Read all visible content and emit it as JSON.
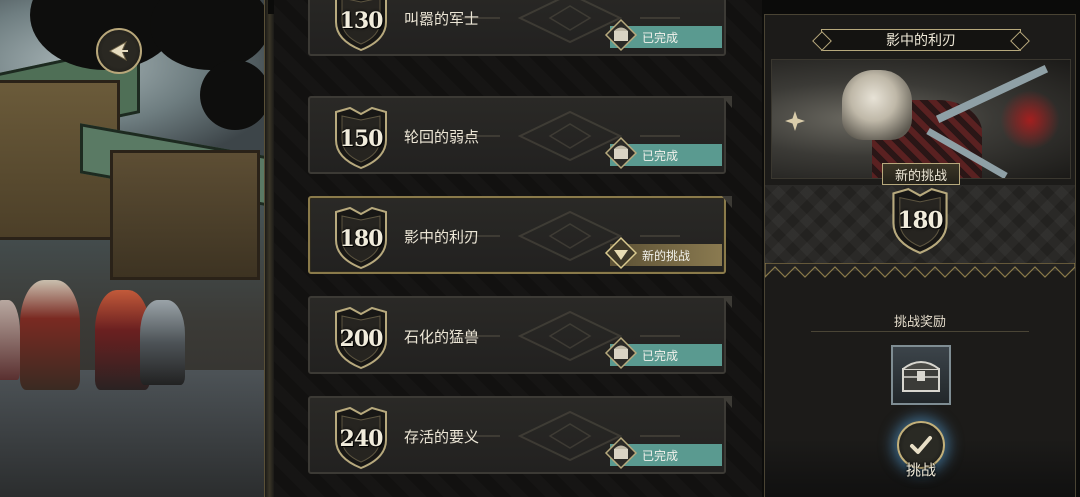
{
  "back_button": {
    "icon": "back-arrow-icon"
  },
  "challenges": [
    {
      "level": "130",
      "title": "叫嚣的军士",
      "status": "已完成",
      "state": "done"
    },
    {
      "level": "150",
      "title": "轮回的弱点",
      "status": "已完成",
      "state": "done"
    },
    {
      "level": "180",
      "title": "影中的利刃",
      "status": "新的挑战",
      "state": "new"
    },
    {
      "level": "200",
      "title": "石化的猛兽",
      "status": "已完成",
      "state": "done"
    },
    {
      "level": "240",
      "title": "存活的要义",
      "status": "已完成",
      "state": "done"
    }
  ],
  "detail": {
    "title": "影中的利刃",
    "badge": "新的挑战",
    "level": "180",
    "reward_title": "挑战奖励",
    "reward_item": "treasure-chest-icon",
    "action_label": "挑战"
  },
  "colors": {
    "done_status": "#5a9a90",
    "new_status": "#8a7a50",
    "gold_trim": "#b7a97d"
  }
}
